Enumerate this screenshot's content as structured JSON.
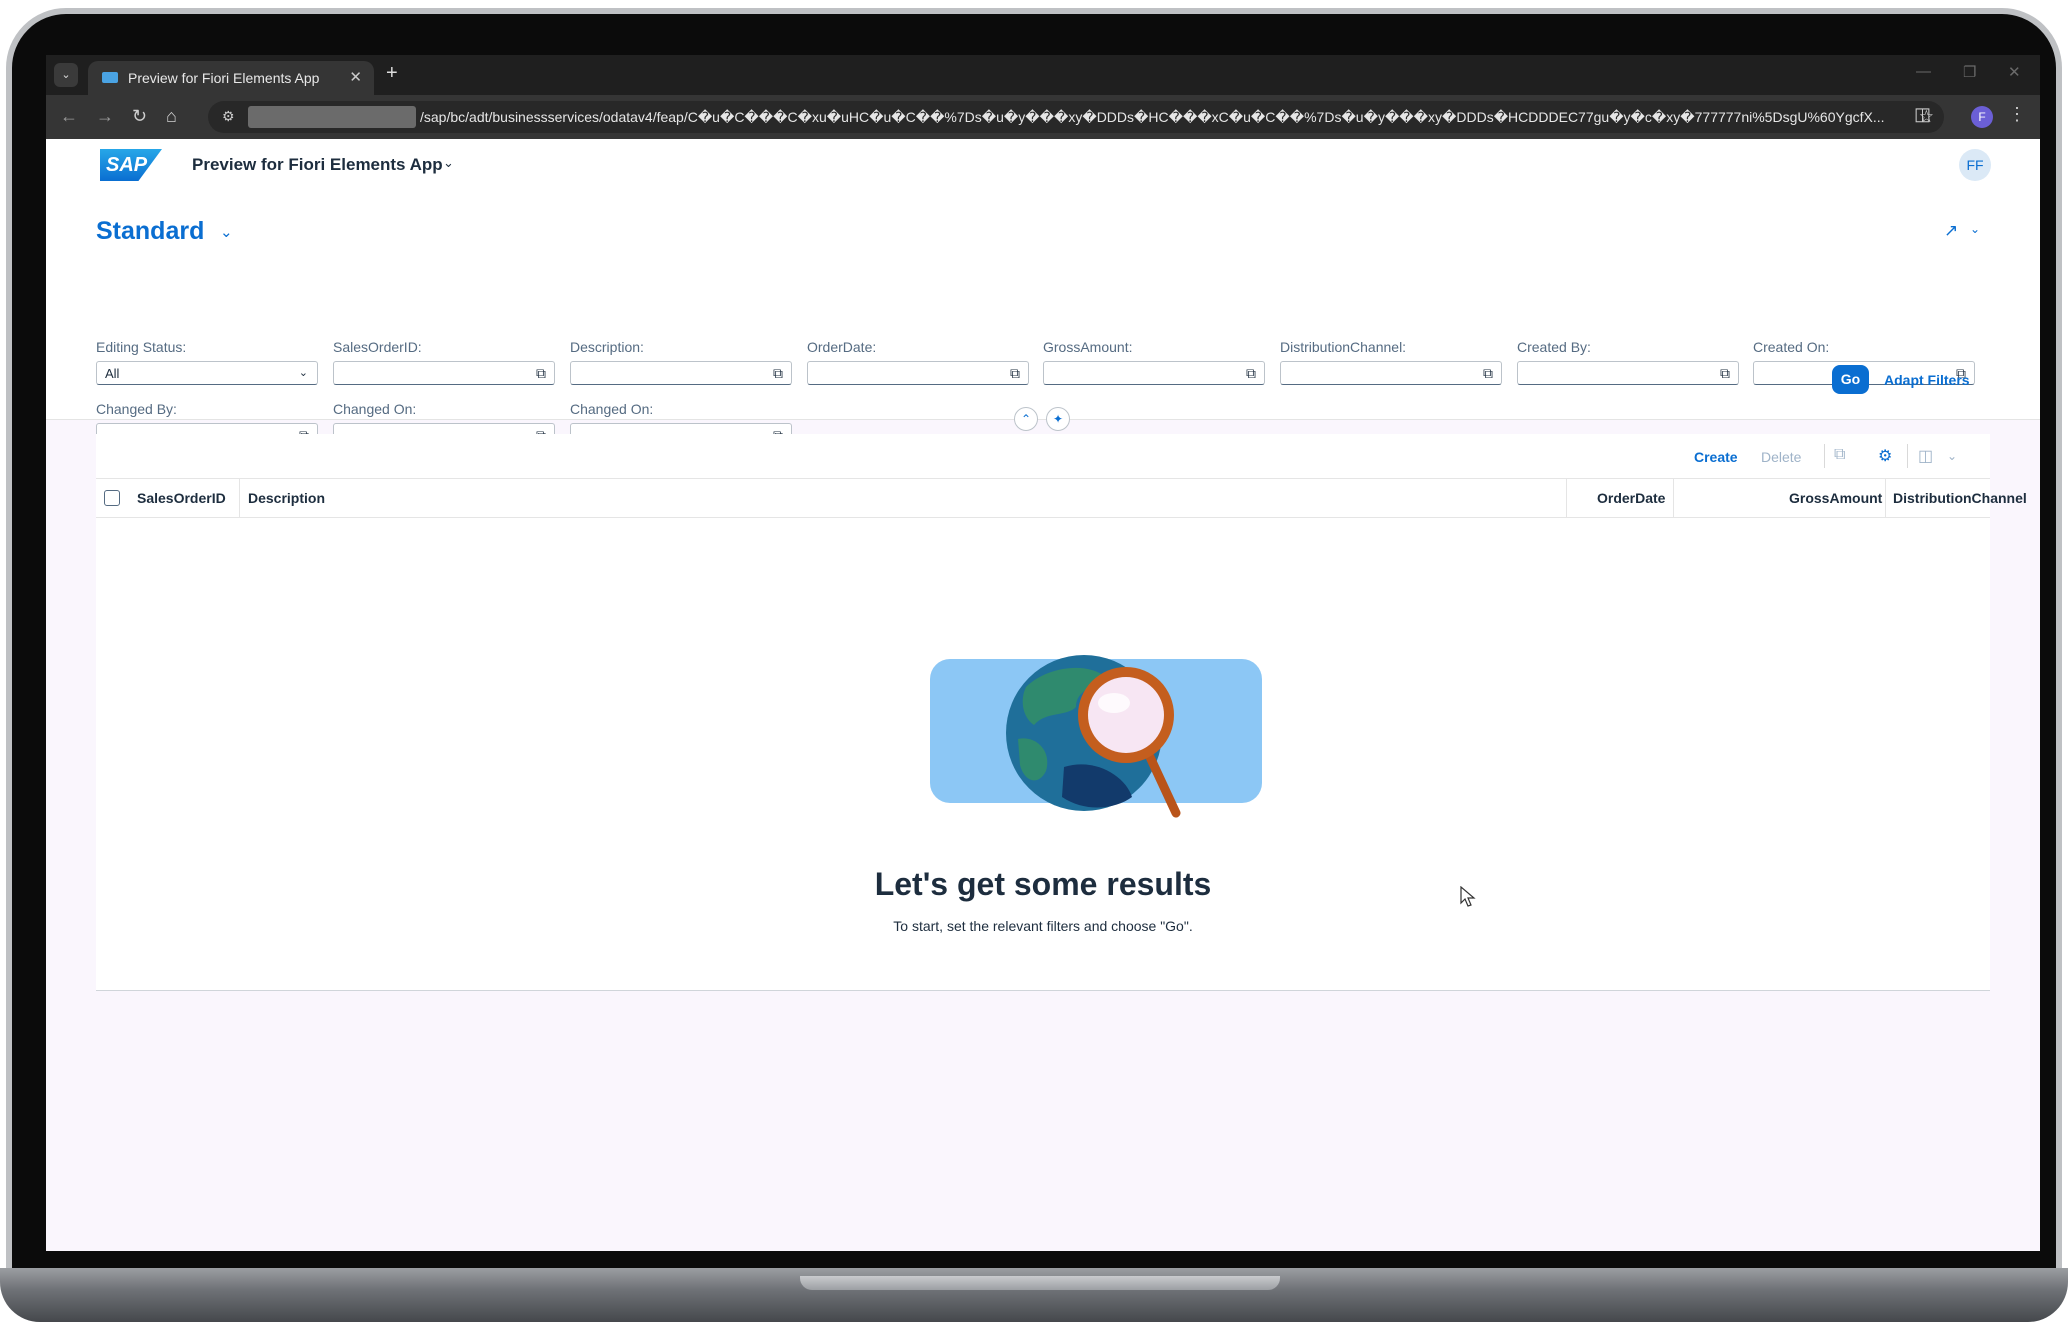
{
  "browser": {
    "tab_title": "Preview for Fiori Elements App",
    "url": "/sap/bc/adt/businessservices/odatav4/feap/C�u�C���C�xu�uHC�u�C��%7Ds�u�y���xy�DDDs�HC���xC�u�C��%7Ds�u�y���xy�DDDs�HCDDDEC77gu�y�c�xy�777777ni%5DsgU%60YgcfX...",
    "profile_initial": "F"
  },
  "shell": {
    "logo_text": "SAP",
    "app_title": "Preview for Fiori Elements App",
    "avatar_initials": "FF"
  },
  "header": {
    "variant_name": "Standard"
  },
  "filters": [
    {
      "label": "Editing Status:",
      "value": "All",
      "type": "select"
    },
    {
      "label": "SalesOrderID:",
      "value": ""
    },
    {
      "label": "Description:",
      "value": ""
    },
    {
      "label": "OrderDate:",
      "value": ""
    },
    {
      "label": "GrossAmount:",
      "value": ""
    },
    {
      "label": "DistributionChannel:",
      "value": ""
    },
    {
      "label": "Created By:",
      "value": ""
    },
    {
      "label": "Created On:",
      "value": ""
    },
    {
      "label": "Changed By:",
      "value": ""
    },
    {
      "label": "Changed On:",
      "value": ""
    },
    {
      "label": "Changed On:",
      "value": ""
    }
  ],
  "filterbar": {
    "go_label": "Go",
    "adapt_label": "Adapt Filters"
  },
  "table": {
    "toolbar": {
      "create_label": "Create",
      "delete_label": "Delete"
    },
    "columns": [
      "SalesOrderID",
      "Description",
      "OrderDate",
      "GrossAmount",
      "DistributionChannel"
    ],
    "empty_title": "Let's get some results",
    "empty_description": "To start, set the relevant filters and choose \"Go\"."
  },
  "colors": {
    "accent": "#0a6ed1",
    "page_background": "#faf6fd",
    "text": "#1d2d3e"
  }
}
